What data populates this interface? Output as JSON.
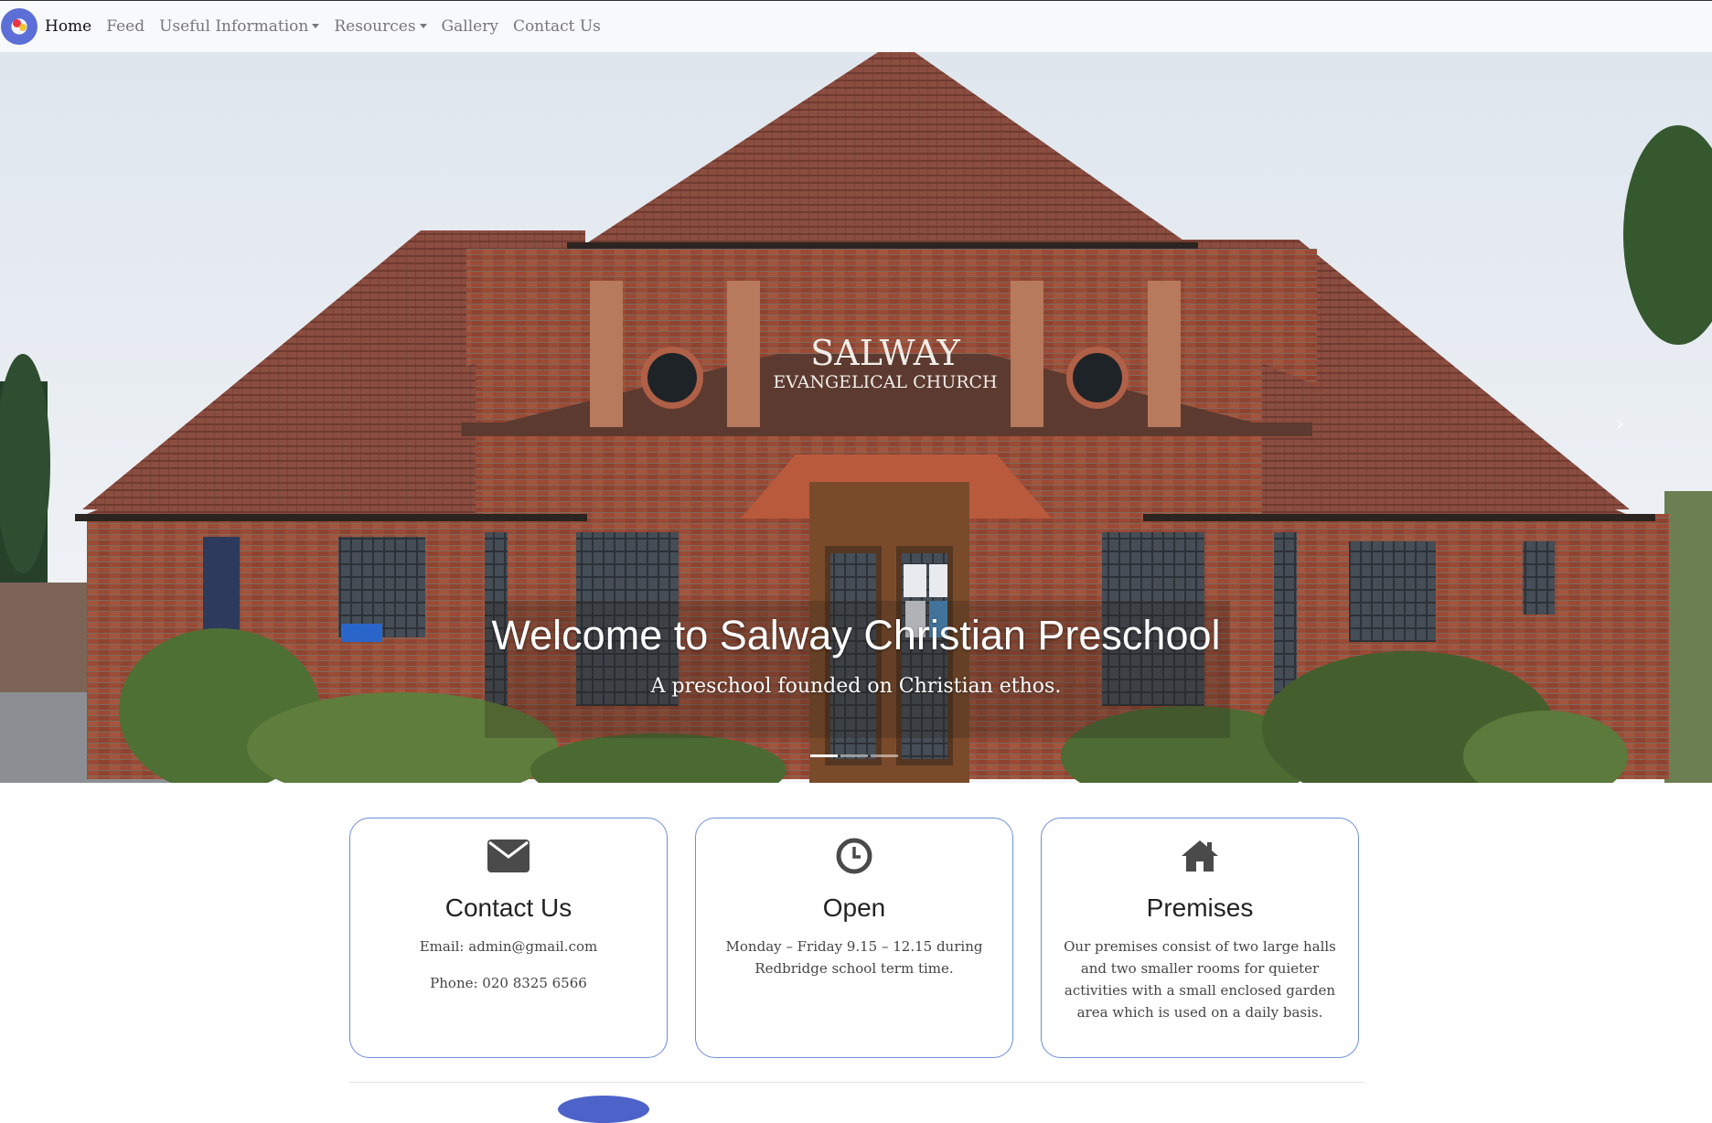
{
  "nav": {
    "logo_icon": "salway-logo-icon",
    "items": [
      {
        "label": "Home",
        "active": true,
        "dropdown": false
      },
      {
        "label": "Feed",
        "active": false,
        "dropdown": false
      },
      {
        "label": "Useful Information",
        "active": false,
        "dropdown": true
      },
      {
        "label": "Resources",
        "active": false,
        "dropdown": true
      },
      {
        "label": "Gallery",
        "active": false,
        "dropdown": false
      },
      {
        "label": "Contact Us",
        "active": false,
        "dropdown": false
      }
    ]
  },
  "hero": {
    "sign_line1": "SALWAY",
    "sign_line2": "EVANGELICAL CHURCH",
    "title": "Welcome to Salway Christian Preschool",
    "subtitle": "A preschool founded on Christian ethos.",
    "slides_count": 3,
    "active_slide": 1,
    "next_icon": "chevron-right-icon"
  },
  "cards": [
    {
      "icon": "envelope-icon",
      "title": "Contact Us",
      "lines": [
        "Email: admin@gmail.com",
        "Phone: 020 8325 6566"
      ]
    },
    {
      "icon": "clock-icon",
      "title": "Open",
      "lines": [
        "Monday – Friday 9.15 – 12.15 during Redbridge school term time."
      ]
    },
    {
      "icon": "home-icon",
      "title": "Premises",
      "lines": [
        "Our premises consist of two large halls and two smaller rooms for quieter activities with a small enclosed garden area which is used on a daily basis."
      ]
    }
  ],
  "colors": {
    "card_border": "#6c8fd8",
    "navbar_bg": "#f8f9fa",
    "brick": "#9a4a36",
    "roof": "#8a4c3e"
  }
}
